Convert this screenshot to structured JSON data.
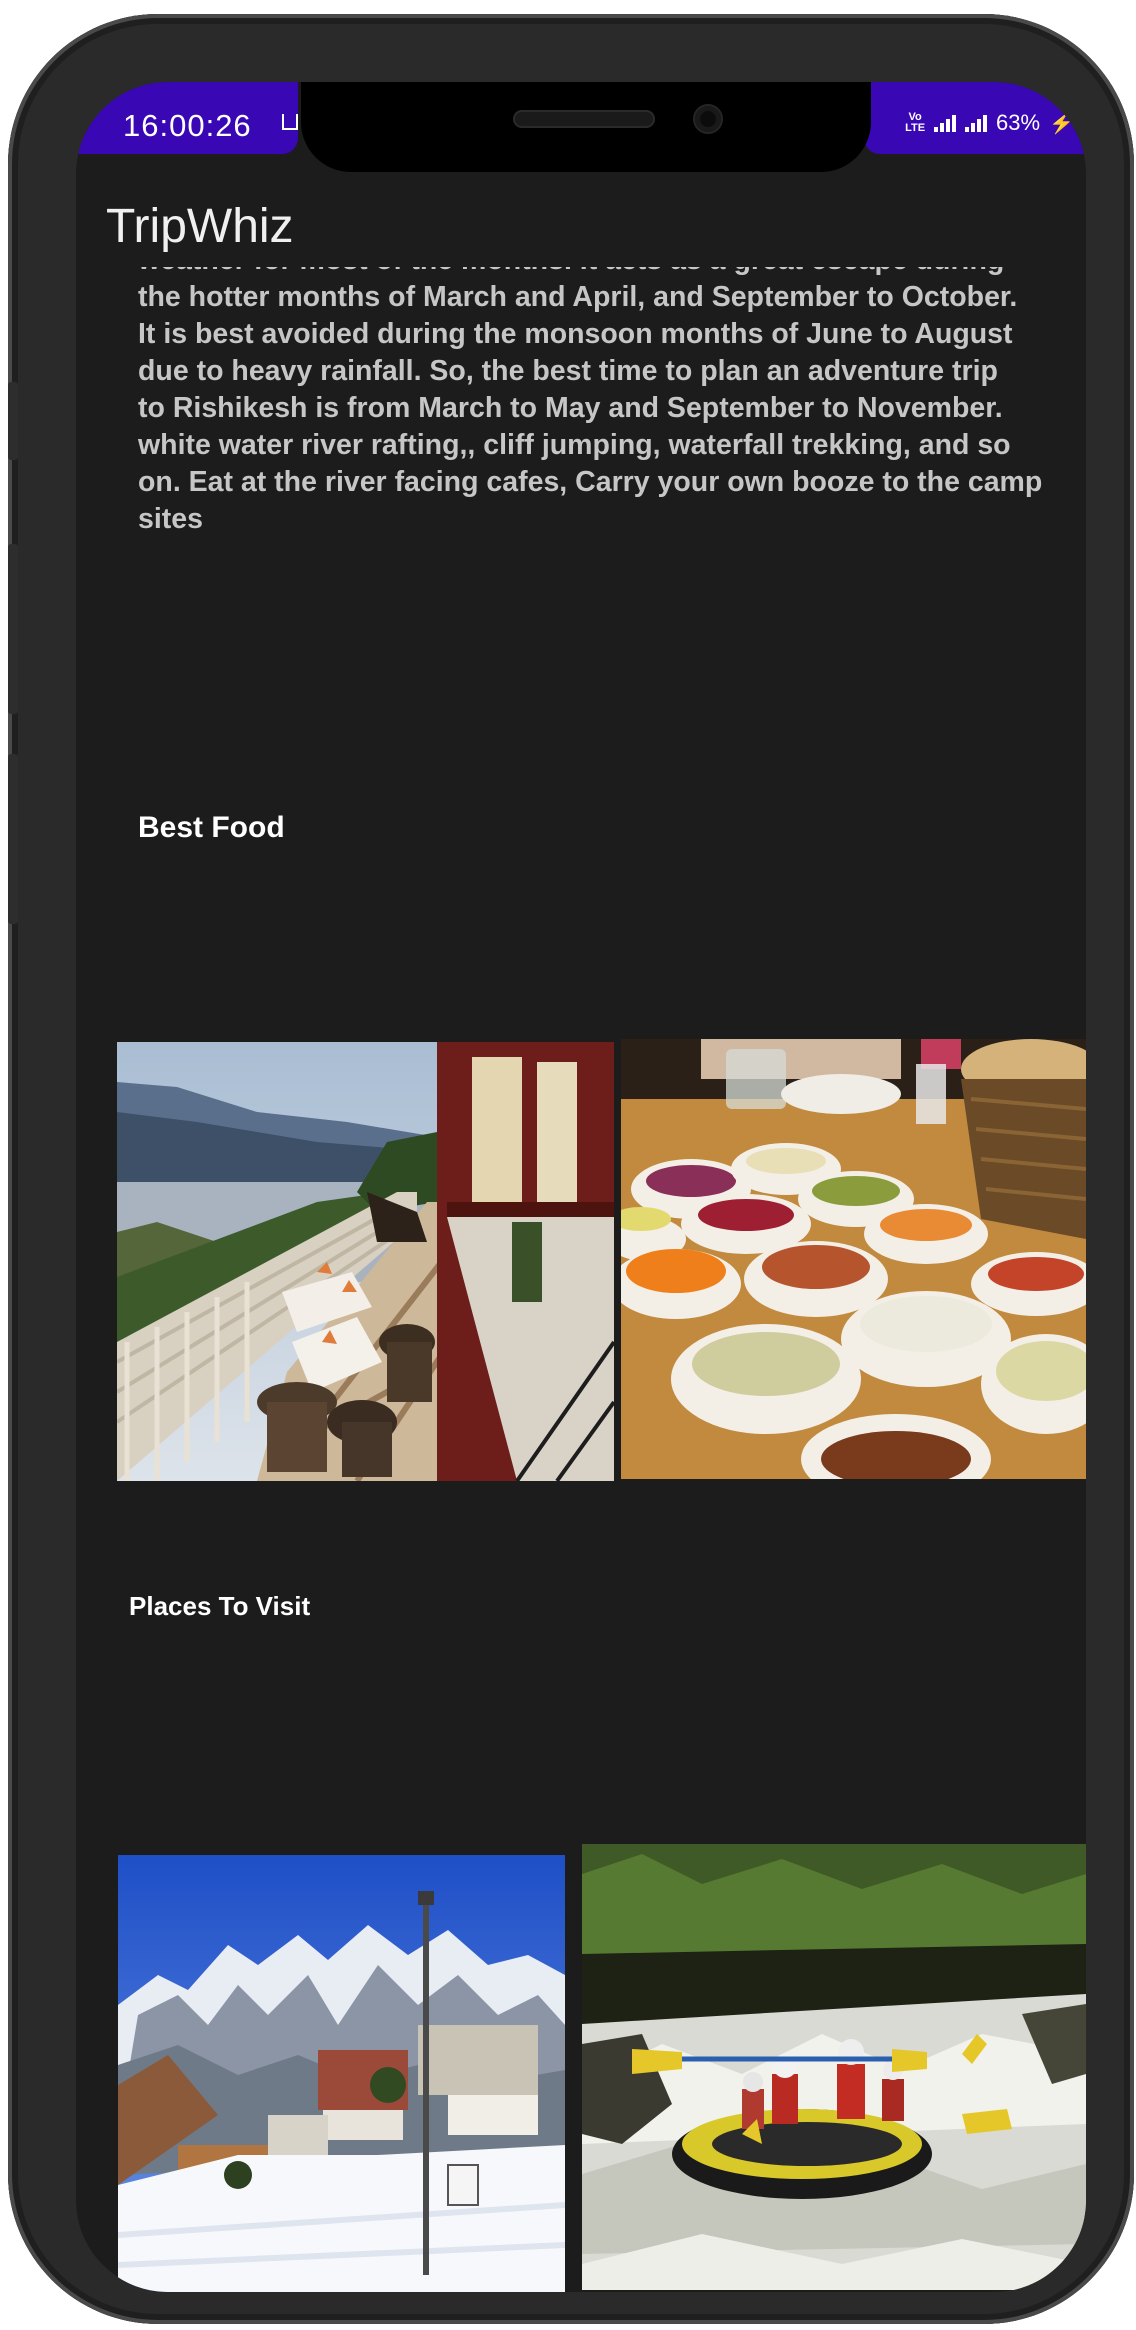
{
  "status_bar": {
    "time": "16:00:26",
    "network_label": "Vo LTE",
    "battery": "63%"
  },
  "app": {
    "title": "TripWhiz"
  },
  "description_lines": [
    "weather for most of the months. It acts as a great escape during",
    "the hotter months of March and April, and September to October.",
    "It is best avoided during the monsoon months of June to August",
    "due to heavy rainfall. So, the best time to plan an adventure trip",
    "to Rishikesh is from March to May and September to November.",
    "white water river rafting,, cliff jumping, waterfall trekking, and so",
    "on. Eat at the river facing cafes, Carry your own booze to the camp",
    "sites"
  ],
  "sections": {
    "best_food": {
      "title": "Best Food",
      "images": [
        "riverside-cafe-balcony",
        "food-bowls-platter"
      ]
    },
    "places_to_visit": {
      "title": "Places To Visit",
      "images": [
        "snowy-mountain-town",
        "river-rafting"
      ]
    }
  },
  "colors": {
    "status_bar": "#3a07b5",
    "background": "#1c1c1c",
    "title_text": "#f0f0f0",
    "body_text": "#c6c6c6"
  }
}
